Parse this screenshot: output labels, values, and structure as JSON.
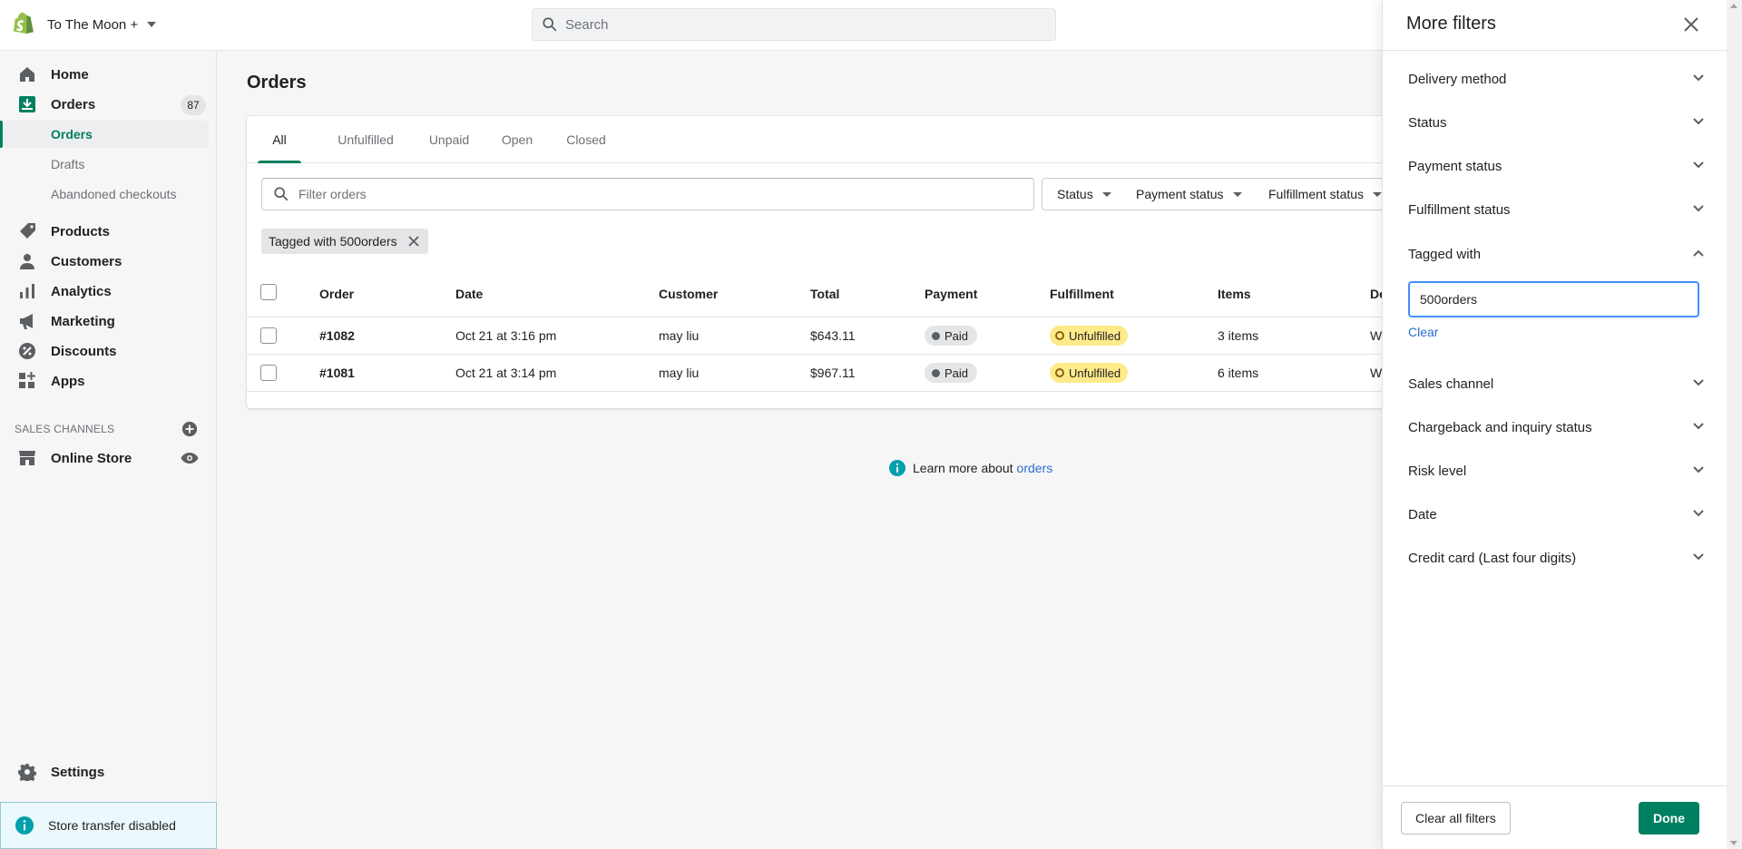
{
  "topbar": {
    "store_name": "To The Moon +",
    "search_placeholder": "Search"
  },
  "sidebar": {
    "home": "Home",
    "orders": "Orders",
    "orders_count": "87",
    "orders_sub": [
      "Orders",
      "Drafts",
      "Abandoned checkouts"
    ],
    "products": "Products",
    "customers": "Customers",
    "analytics": "Analytics",
    "marketing": "Marketing",
    "discounts": "Discounts",
    "apps": "Apps",
    "sales_channels_title": "SALES CHANNELS",
    "online_store": "Online Store",
    "settings": "Settings",
    "store_transfer": "Store transfer disabled"
  },
  "main": {
    "title": "Orders",
    "tabs": [
      "All",
      "Unfulfilled",
      "Unpaid",
      "Open",
      "Closed"
    ],
    "filter_placeholder": "Filter orders",
    "filter_buttons": [
      "Status",
      "Payment status",
      "Fulfillment status"
    ],
    "applied_tag": "Tagged with 500orders",
    "columns": [
      "Order",
      "Date",
      "Customer",
      "Total",
      "Payment",
      "Fulfillment",
      "Items",
      "De"
    ],
    "rows": [
      {
        "order": "#1082",
        "date": "Oct 21 at 3:16 pm",
        "customer": "may liu",
        "total": "$643.11",
        "payment": "Paid",
        "fulfillment": "Unfulfilled",
        "items": "3 items",
        "delivery": "W"
      },
      {
        "order": "#1081",
        "date": "Oct 21 at 3:14 pm",
        "customer": "may liu",
        "total": "$967.11",
        "payment": "Paid",
        "fulfillment": "Unfulfilled",
        "items": "6 items",
        "delivery": "W"
      }
    ],
    "learn_more_prefix": "Learn more about",
    "learn_more_link": "orders"
  },
  "panel": {
    "title": "More filters",
    "filters": [
      "Delivery method",
      "Status",
      "Payment status",
      "Fulfillment status",
      "Tagged with",
      "Sales channel",
      "Chargeback and inquiry status",
      "Risk level",
      "Date",
      "Credit card (Last four digits)"
    ],
    "tagged_value": "500orders",
    "clear": "Clear",
    "clear_all": "Clear all filters",
    "done": "Done"
  },
  "colors": {
    "brand_green": "#008060",
    "link_blue": "#2c6ecb",
    "unfulfilled_yellow": "#ffea8a",
    "focus_blue": "#458fff"
  }
}
